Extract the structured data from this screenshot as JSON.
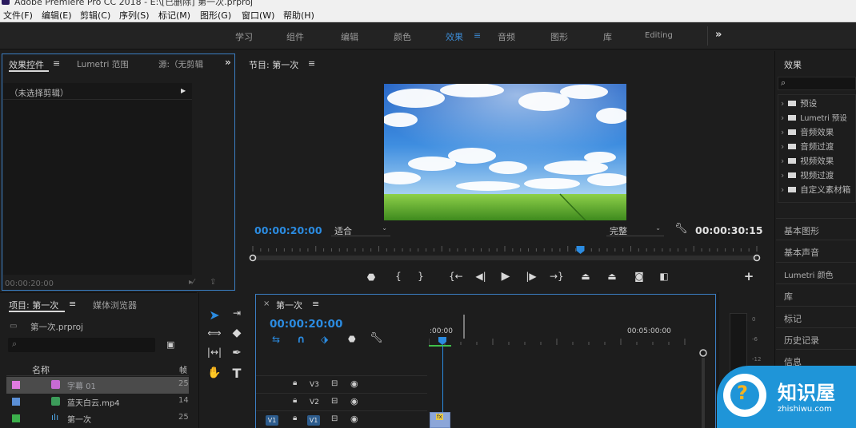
{
  "app": {
    "title": "Adobe Premiere Pro CC 2018 - E:\\[已删除] 第一次.prproj"
  },
  "menu": [
    "文件(F)",
    "编辑(E)",
    "剪辑(C)",
    "序列(S)",
    "标记(M)",
    "图形(G)",
    "窗口(W)",
    "帮助(H)"
  ],
  "workspaces": {
    "items": [
      "学习",
      "组件",
      "编辑",
      "颜色",
      "效果",
      "音频",
      "图形",
      "库",
      "Editing"
    ],
    "active": "效果",
    "more": "»"
  },
  "effect_controls": {
    "tab_effects": "效果控件",
    "tab_lumetri": "Lumetri 范围",
    "tab_source": "源:（无剪辑",
    "more": "»",
    "no_clip": "（未选择剪辑）",
    "timecode": "00:00:20:00"
  },
  "program": {
    "title": "节目: 第一次",
    "timecode": "00:00:20:00",
    "fit": "适合",
    "quality": "完整",
    "duration": "00:00:30:15",
    "playhead_fraction": 0.65
  },
  "effects_panel": {
    "title": "效果",
    "folders": [
      "预设",
      "Lumetri 预设",
      "音频效果",
      "音频过渡",
      "视频效果",
      "视频过渡",
      "自定义素材箱"
    ],
    "sections": [
      "基本图形",
      "基本声音",
      "Lumetri 颜色",
      "库",
      "标记",
      "历史记录",
      "信息"
    ]
  },
  "project": {
    "tab_project": "项目: 第一次",
    "tab_media": "媒体浏览器",
    "file": "第一次.prproj",
    "col_name": "名称",
    "col_rate": "帧",
    "items": [
      {
        "name": "字幕 01",
        "rate": "25",
        "color": "#e07be0",
        "icon_color": "#c76bd4"
      },
      {
        "name": "蓝天白云.mp4",
        "rate": "14",
        "color": "#5b8fd6",
        "icon_color": "#3c9c5a"
      },
      {
        "name": "第一次",
        "rate": "25",
        "color": "#3cb04c",
        "icon_color": "#3c8ac4"
      }
    ]
  },
  "timeline": {
    "tab": "第一次",
    "timecode": "00:00:20:00",
    "ruler_start": ":00:00",
    "ruler_mid": "00:05:00:00",
    "tracks": [
      "V3",
      "V2",
      "V1"
    ],
    "source_patch": "V1",
    "clip_label": "fx"
  },
  "watermark": {
    "brand": "知识屋",
    "url": "zhishiwu.com"
  },
  "colors": {
    "accent": "#2b8be0",
    "panel_border": "#3b7fc4",
    "background": "#1d1d1d",
    "watermark": "#1f95d8"
  }
}
